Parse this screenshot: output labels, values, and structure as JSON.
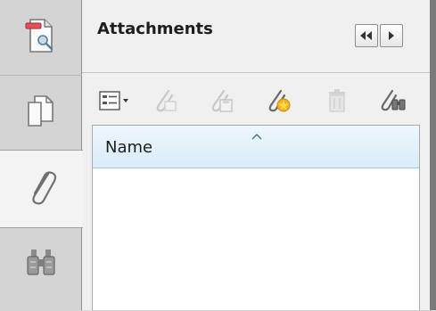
{
  "tabs": {
    "items": [
      {
        "id": "signatures",
        "icon": "signature-page-icon"
      },
      {
        "id": "pages",
        "icon": "pages-icon"
      },
      {
        "id": "attachments",
        "icon": "paperclip-icon"
      },
      {
        "id": "search",
        "icon": "binoculars-icon"
      }
    ],
    "active": "attachments"
  },
  "panel": {
    "title": "Attachments",
    "nav": {
      "back_icon": "double-left-arrow-icon",
      "forward_icon": "right-arrow-icon"
    }
  },
  "toolbar": {
    "items": [
      {
        "id": "options",
        "icon": "list-options-icon",
        "enabled": true
      },
      {
        "id": "open",
        "icon": "open-attachment-icon",
        "enabled": false
      },
      {
        "id": "save",
        "icon": "save-attachment-icon",
        "enabled": false
      },
      {
        "id": "add",
        "icon": "add-attachment-icon",
        "enabled": true
      },
      {
        "id": "delete",
        "icon": "trash-icon",
        "enabled": false
      },
      {
        "id": "search",
        "icon": "search-attachments-icon",
        "enabled": true
      }
    ]
  },
  "list": {
    "columns": [
      {
        "label": "Name",
        "sort": "ascending"
      }
    ],
    "rows": []
  },
  "colors": {
    "header_gradient_top": "#eef7fc",
    "header_gradient_bottom": "#d9ecf8",
    "panel_bg": "#f0f0f0"
  }
}
